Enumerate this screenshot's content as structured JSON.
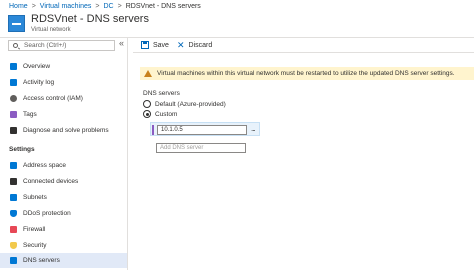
{
  "breadcrumb": {
    "items": [
      "Home",
      "Virtual machines",
      "DC",
      "RDSVnet - DNS servers"
    ],
    "separator": ">"
  },
  "header": {
    "title": "RDSVnet - DNS servers",
    "subtitle": "Virtual network"
  },
  "sidebar": {
    "search_placeholder": "Search (Ctrl+/)",
    "collapse_glyph": "«",
    "items": [
      {
        "label": "Overview",
        "icon": "overview-icon",
        "color": "#0078d4"
      },
      {
        "label": "Activity log",
        "icon": "activity-log-icon",
        "color": "#0078d4"
      },
      {
        "label": "Access control (IAM)",
        "icon": "iam-icon",
        "color": "#605e5c"
      },
      {
        "label": "Tags",
        "icon": "tag-icon",
        "color": "#8b5cc2"
      },
      {
        "label": "Diagnose and solve problems",
        "icon": "wrench-icon",
        "color": "#323130"
      }
    ],
    "settings_header": "Settings",
    "settings_items": [
      {
        "label": "Address space",
        "icon": "address-space-icon",
        "color": "#0078d4"
      },
      {
        "label": "Connected devices",
        "icon": "connected-devices-icon",
        "color": "#323130"
      },
      {
        "label": "Subnets",
        "icon": "subnets-icon",
        "color": "#0078d4"
      },
      {
        "label": "DDoS protection",
        "icon": "shield-icon",
        "color": "#0078d4"
      },
      {
        "label": "Firewall",
        "icon": "firewall-icon",
        "color": "#e74856"
      },
      {
        "label": "Security",
        "icon": "security-icon",
        "color": "#f2c94c"
      },
      {
        "label": "DNS servers",
        "icon": "dns-icon",
        "color": "#0078d4",
        "active": true
      }
    ]
  },
  "toolbar": {
    "save_label": "Save",
    "discard_label": "Discard"
  },
  "banner": {
    "text": "Virtual machines within this virtual network must be restarted to utilize the updated DNS server settings."
  },
  "dns": {
    "label": "DNS servers",
    "option_default": "Default (Azure-provided)",
    "option_custom": "Custom",
    "server_value": "10.1.0.5",
    "add_placeholder": "Add DNS server",
    "more_glyph": "..."
  },
  "colors": {
    "accent": "#0078d4",
    "active_nav": "#e1e9f7",
    "banner_bg": "#fff4ce"
  }
}
